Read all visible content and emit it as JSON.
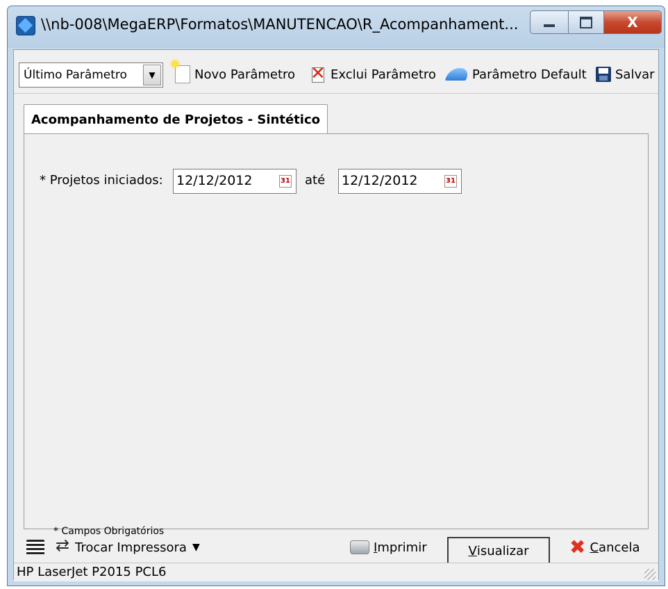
{
  "window": {
    "title": "\\\\nb-008\\MegaERP\\Formatos\\MANUTENCAO\\R_Acompanhament...",
    "close_glyph": "X"
  },
  "toolbar": {
    "param_select": "Último Parâmetro",
    "new_param": "Novo Parâmetro",
    "delete_param": "Exclui Parâmetro",
    "default_param": "Parâmetro Default",
    "save": "Salvar"
  },
  "tabs": [
    {
      "label": "Acompanhamento de Projetos - Sintético",
      "active": true
    }
  ],
  "form": {
    "projects_label": "* Projetos iniciados:",
    "date_from": "12/12/2012",
    "until_label": "até",
    "date_to": "12/12/2012",
    "required_note": "* Campos Obrigatórios"
  },
  "bottom": {
    "change_printer": "Trocar Impressora",
    "print_first": "I",
    "print_rest": "mprimir",
    "view_first": "V",
    "view_rest": "isualizar",
    "cancel_first": "C",
    "cancel_rest": "ancela"
  },
  "status": {
    "printer_name": "HP LaserJet P2015 PCL6"
  },
  "icons": {
    "app": "app-icon",
    "new": "new-document-icon",
    "delete": "delete-document-icon",
    "default": "default-icon",
    "save": "floppy-disk-icon",
    "calendar": "calendar-icon",
    "printer": "printer-icon",
    "swap": "swap-printer-icon",
    "cancel": "red-x-icon"
  },
  "colors": {
    "title_bar": "#c9dced",
    "close_button": "#c74a30",
    "window_body": "#f0f0f0"
  }
}
